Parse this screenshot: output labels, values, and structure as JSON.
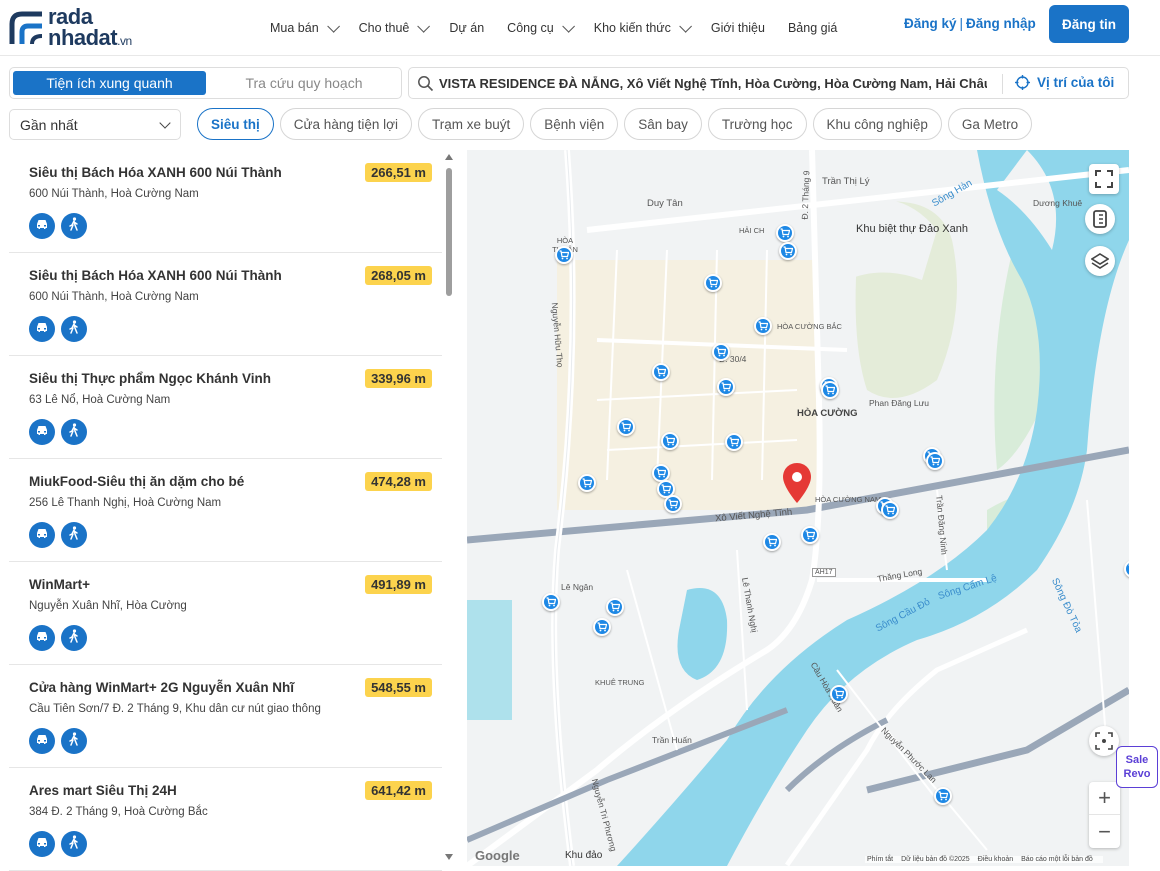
{
  "brand": {
    "line1": "rada",
    "line2": "nhadat",
    "suffix": ".vn"
  },
  "nav": [
    {
      "label": "Mua bán",
      "has_dropdown": true
    },
    {
      "label": "Cho thuê",
      "has_dropdown": true
    },
    {
      "label": "Dự án",
      "has_dropdown": false
    },
    {
      "label": "Công cụ",
      "has_dropdown": true
    },
    {
      "label": "Kho kiến thức",
      "has_dropdown": true
    },
    {
      "label": "Giới thiệu",
      "has_dropdown": false
    },
    {
      "label": "Bảng giá",
      "has_dropdown": false
    }
  ],
  "auth": {
    "register": "Đăng ký",
    "separator": "|",
    "login": "Đăng nhập"
  },
  "post_button": "Đăng tin",
  "mode_tabs": {
    "active": "Tiện ích xung quanh",
    "inactive": "Tra cứu quy hoạch"
  },
  "search": {
    "value": "VISTA RESIDENCE ĐÀ NẴNG, Xô Viết Nghệ Tĩnh, Hòa Cường, Hòa Cường Nam, Hải Châu",
    "locate_label": "Vị trí của tôi"
  },
  "sort": {
    "selected": "Gần nhất"
  },
  "categories": [
    "Siêu thị",
    "Cửa hàng tiện lợi",
    "Trạm xe buýt",
    "Bệnh viện",
    "Sân bay",
    "Trường học",
    "Khu công nghiệp",
    "Ga Metro"
  ],
  "active_category": "Siêu thị",
  "results": [
    {
      "name": "Siêu thị Bách Hóa XANH 600 Núi Thành",
      "distance": "266,51 m",
      "address": "600 Núi Thành, Hoà Cường Nam"
    },
    {
      "name": "Siêu thị Bách Hóa XANH 600 Núi Thành",
      "distance": "268,05 m",
      "address": "600 Núi Thành, Hoà Cường Nam"
    },
    {
      "name": "Siêu thị Thực phẩm Ngọc Khánh Vinh",
      "distance": "339,96 m",
      "address": "63 Lê Nổ, Hoà Cường Nam"
    },
    {
      "name": "MiukFood-Siêu thị ăn dặm cho bé",
      "distance": "474,28 m",
      "address": "256 Lê Thanh Nghị, Hoà Cường Nam"
    },
    {
      "name": "WinMart+",
      "distance": "491,89 m",
      "address": "Nguyễn Xuân Nhĩ, Hòa Cường"
    },
    {
      "name": "Cửa hàng WinMart+ 2G Nguyễn Xuân Nhĩ",
      "distance": "548,55 m",
      "address": "Cầu Tiên Sơn/7 Đ. 2 Tháng 9, Khu dân cư nút giao thông"
    },
    {
      "name": "Ares mart Siêu Thị 24H",
      "distance": "641,42 m",
      "address": "384 Đ. 2 Tháng 9, Hoà Cường Bắc"
    }
  ],
  "map": {
    "labels": {
      "hoa_cuong": "HÒA CƯỜNG",
      "hoa_cuong_nam": "HÒA CƯỜNG NAM",
      "hoa_cuong_bac": "HÒA CƯỜNG BẮC",
      "hai_chau": "HẢI CH",
      "hoa_thuan_tay": "HÒA THUẬN TÂY",
      "khue_trung": "KHUÊ TRUNG",
      "khu_biet_thu": "Khu biệt thự Đảo Xanh",
      "xo_viet": "Xô Viết Nghệ Tĩnh",
      "duy_tan": "Duy Tân",
      "tran_thi_ly": "Trần Thị Lý",
      "thang_long": "Thăng Long",
      "song_han": "Sông Hàn",
      "song_cam_le": "Sông Cẩm Lệ",
      "song_cau_do": "Sông Cầu Đỏ",
      "song_do_toa": "Sông Đò Tỏa",
      "ah17": "AH17",
      "khu_dao": "Khu đảo",
      "phan_dang_luu": "Phan Đăng Lưu",
      "nguyen_huu_tho": "Nguyễn Hữu Thọ",
      "le_thanh_nghi": "Lê Thanh Nghị",
      "d_2_thang_9": "Đ. 2 Tháng 9",
      "duong_30_4": "Đ. 30/4",
      "tran_dang_ninh": "Trần Đăng Ninh",
      "cau_hoa_xuan": "Cầu Hòa Xuân",
      "nguyen_tri_phuong": "Nguyễn Tri Phương",
      "tran_huan": "Trần Huấn",
      "le_ngan": "Lê Ngân",
      "duong_khue": "Dương Khuê",
      "nguyen_phuoc_lan": "Nguyễn Phước Lan"
    },
    "google": "Google",
    "attribution": [
      "Phím tắt",
      "Dữ liệu bản đồ ©2025",
      "Điều khoản",
      "Báo cáo một lỗi bản đồ"
    ]
  },
  "promo": {
    "line1": "Sale",
    "line2": "Revo"
  }
}
